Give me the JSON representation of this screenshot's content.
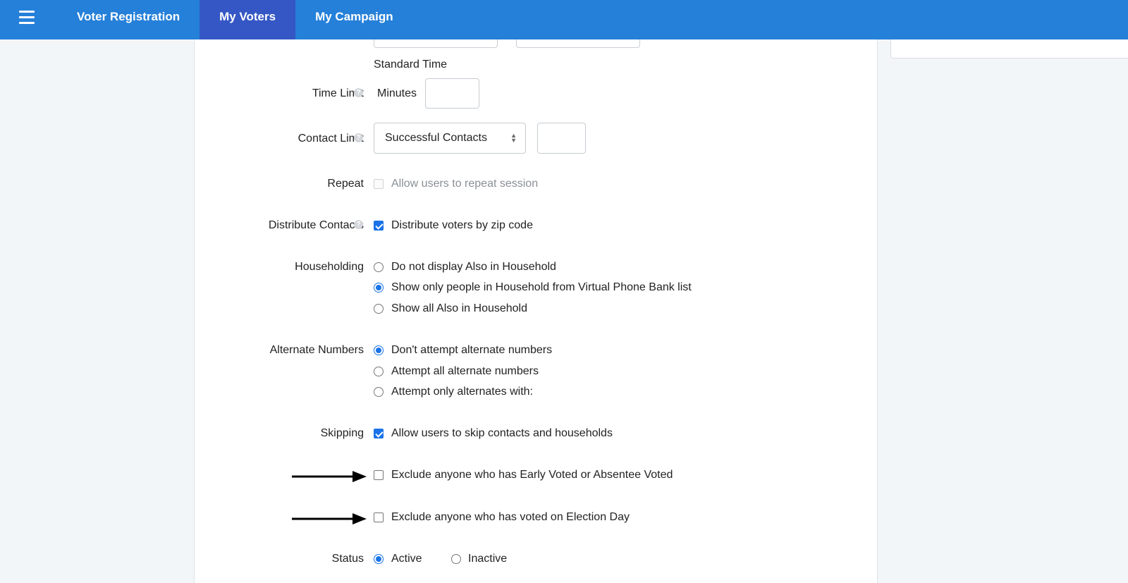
{
  "nav": {
    "tabs": [
      {
        "label": "Voter Registration"
      },
      {
        "label": "My Voters"
      },
      {
        "label": "My Campaign"
      }
    ],
    "active_tab": "My Voters"
  },
  "form": {
    "standard_time": "Standard Time",
    "time_limit": {
      "label": "Time Limit",
      "unit": "Minutes",
      "value": ""
    },
    "contact_limit": {
      "label": "Contact Limit",
      "select_value": "Successful Contacts",
      "value": ""
    },
    "repeat": {
      "label": "Repeat",
      "option": "Allow users to repeat session",
      "checked": false,
      "disabled": true
    },
    "distribute": {
      "label": "Distribute Contacts",
      "option": "Distribute voters by zip code",
      "checked": true
    },
    "householding": {
      "label": "Householding",
      "options": [
        "Do not display Also in Household",
        "Show only people in Household from Virtual Phone Bank list",
        "Show all Also in Household"
      ],
      "selected_index": 1
    },
    "alternate_numbers": {
      "label": "Alternate Numbers",
      "options": [
        "Don't attempt alternate numbers",
        "Attempt all alternate numbers",
        "Attempt only alternates with:"
      ],
      "selected_index": 0
    },
    "skipping": {
      "label": "Skipping",
      "option": "Allow users to skip contacts and households",
      "checked": true
    },
    "exclude_early": {
      "option": "Exclude anyone who has Early Voted or Absentee Voted",
      "checked": false
    },
    "exclude_election": {
      "option": "Exclude anyone who has voted on Election Day",
      "checked": false
    },
    "status": {
      "label": "Status",
      "options": [
        "Active",
        "Inactive"
      ],
      "selected_index": 0
    }
  },
  "icons": {
    "help": "help-icon",
    "menu": "hamburger-menu-icon",
    "arrow": "arrow-right-icon"
  },
  "colors": {
    "nav_bg": "#2580d9",
    "nav_active": "#3457c5",
    "accent": "#1a73e8"
  }
}
